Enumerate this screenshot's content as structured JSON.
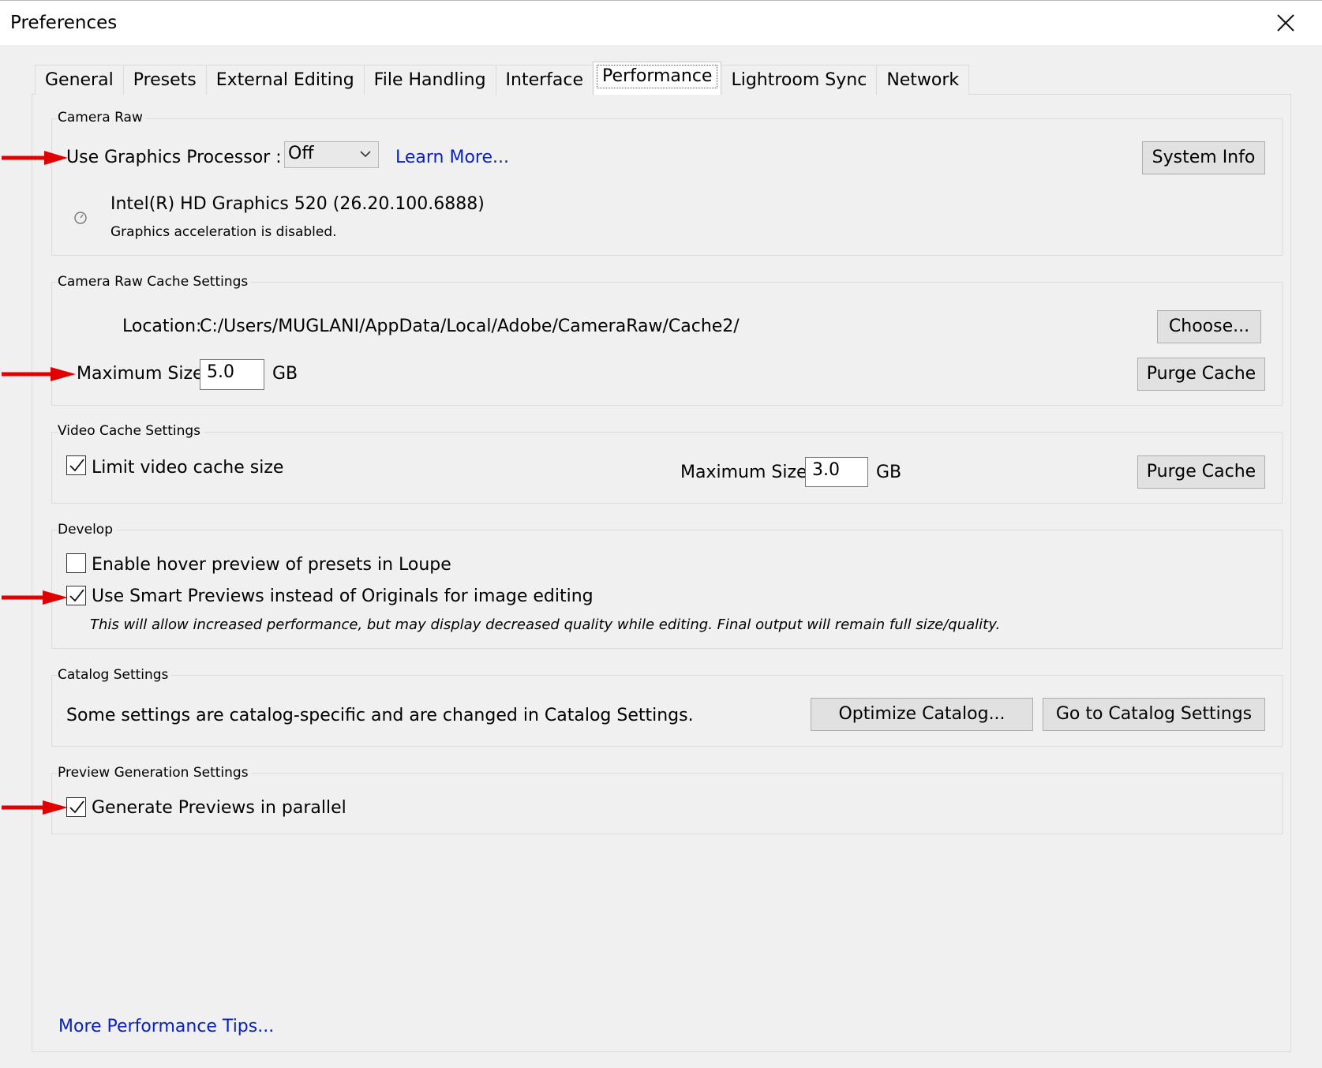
{
  "window": {
    "title": "Preferences"
  },
  "tabs": [
    {
      "label": "General"
    },
    {
      "label": "Presets"
    },
    {
      "label": "External Editing"
    },
    {
      "label": "File Handling"
    },
    {
      "label": "Interface"
    },
    {
      "label": "Performance"
    },
    {
      "label": "Lightroom Sync"
    },
    {
      "label": "Network"
    }
  ],
  "active_tab": "Performance",
  "camera_raw": {
    "title": "Camera Raw",
    "gpu_label": "Use Graphics Processor :",
    "gpu_value": "Off",
    "learn_more": "Learn More...",
    "system_info": "System Info",
    "gpu_name": "Intel(R) HD Graphics 520 (26.20.100.6888)",
    "gpu_status": "Graphics acceleration is disabled."
  },
  "cache": {
    "title": "Camera Raw Cache Settings",
    "location_label": "Location:",
    "location_value": "C:/Users/MUGLANI/AppData/Local/Adobe/CameraRaw/Cache2/",
    "choose": "Choose...",
    "max_label": "Maximum Size:",
    "max_value": "5.0",
    "unit": "GB",
    "purge": "Purge Cache"
  },
  "video_cache": {
    "title": "Video Cache Settings",
    "limit_label": "Limit video cache size",
    "limit_checked": true,
    "max_label": "Maximum Size:",
    "max_value": "3.0",
    "unit": "GB",
    "purge": "Purge Cache"
  },
  "develop": {
    "title": "Develop",
    "hover_label": "Enable hover preview of presets in Loupe",
    "hover_checked": false,
    "smart_label": "Use Smart Previews instead of Originals for image editing",
    "smart_checked": true,
    "note": "This will allow increased performance, but may display decreased quality while editing. Final output will remain full size/quality."
  },
  "catalog": {
    "title": "Catalog Settings",
    "text": "Some settings are catalog-specific and are changed in Catalog Settings.",
    "optimize": "Optimize Catalog...",
    "goto": "Go to Catalog Settings"
  },
  "preview": {
    "title": "Preview Generation Settings",
    "parallel_label": "Generate Previews in parallel",
    "parallel_checked": true
  },
  "footer": {
    "tips_link": "More Performance Tips..."
  },
  "colors": {
    "link": "#0a21c4",
    "annotation_arrow": "#e00000",
    "panel_bg": "#f0f0f0"
  }
}
